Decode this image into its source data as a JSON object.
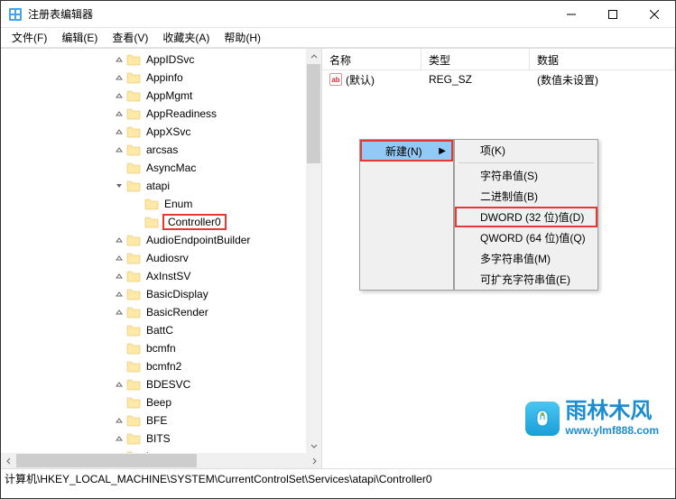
{
  "title": "注册表编辑器",
  "menus": {
    "file": "文件(F)",
    "edit": "编辑(E)",
    "view": "查看(V)",
    "favorites": "收藏夹(A)",
    "help": "帮助(H)"
  },
  "tree": {
    "items": [
      {
        "label": "AppIDSvc",
        "indent": 125,
        "expander": "collapsed"
      },
      {
        "label": "Appinfo",
        "indent": 125,
        "expander": "collapsed"
      },
      {
        "label": "AppMgmt",
        "indent": 125,
        "expander": "collapsed"
      },
      {
        "label": "AppReadiness",
        "indent": 125,
        "expander": "collapsed"
      },
      {
        "label": "AppXSvc",
        "indent": 125,
        "expander": "collapsed"
      },
      {
        "label": "arcsas",
        "indent": 125,
        "expander": "collapsed"
      },
      {
        "label": "AsyncMac",
        "indent": 125,
        "expander": ""
      },
      {
        "label": "atapi",
        "indent": 125,
        "expander": "expanded",
        "prefix": "v"
      },
      {
        "label": "Enum",
        "indent": 145,
        "expander": ""
      },
      {
        "label": "Controller0",
        "indent": 145,
        "expander": "",
        "highlighted": true
      },
      {
        "label": "AudioEndpointBuilder",
        "indent": 125,
        "expander": "collapsed"
      },
      {
        "label": "Audiosrv",
        "indent": 125,
        "expander": "collapsed"
      },
      {
        "label": "AxInstSV",
        "indent": 125,
        "expander": "collapsed"
      },
      {
        "label": "BasicDisplay",
        "indent": 125,
        "expander": "collapsed"
      },
      {
        "label": "BasicRender",
        "indent": 125,
        "expander": "collapsed"
      },
      {
        "label": "BattC",
        "indent": 125,
        "expander": ""
      },
      {
        "label": "bcmfn",
        "indent": 125,
        "expander": ""
      },
      {
        "label": "bcmfn2",
        "indent": 125,
        "expander": ""
      },
      {
        "label": "BDESVC",
        "indent": 125,
        "expander": "collapsed"
      },
      {
        "label": "Beep",
        "indent": 125,
        "expander": ""
      },
      {
        "label": "BFE",
        "indent": 125,
        "expander": "collapsed"
      },
      {
        "label": "BITS",
        "indent": 125,
        "expander": "collapsed"
      },
      {
        "label": "bowser",
        "indent": 125,
        "expander": ""
      }
    ]
  },
  "listHeader": {
    "name": "名称",
    "type": "类型",
    "data": "数据"
  },
  "listRows": [
    {
      "icon": "ab",
      "name": "(默认)",
      "type": "REG_SZ",
      "data": "(数值未设置)"
    }
  ],
  "contextMenu1": {
    "new": "新建(N)"
  },
  "contextMenu2": {
    "key": "项(K)",
    "string": "字符串值(S)",
    "binary": "二进制值(B)",
    "dword": "DWORD (32 位)值(D)",
    "qword": "QWORD (64 位)值(Q)",
    "multistring": "多字符串值(M)",
    "expandstring": "可扩充字符串值(E)"
  },
  "statusPath": "计算机\\HKEY_LOCAL_MACHINE\\SYSTEM\\CurrentControlSet\\Services\\atapi\\Controller0",
  "watermark": {
    "brand": "雨林木风",
    "url": "www.ylmf888.com"
  }
}
